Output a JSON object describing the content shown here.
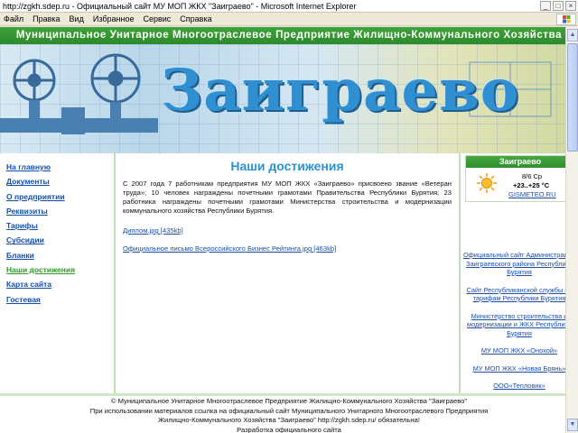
{
  "window": {
    "title": "http://zgkh.sdep.ru - Официальный сайт МУ МОП ЖКХ \"Заиграево\" - Microsoft Internet Explorer",
    "buttons": [
      "_",
      "□",
      "×"
    ]
  },
  "menubar": {
    "items": [
      "Файл",
      "Правка",
      "Вид",
      "Избранное",
      "Сервис",
      "Справка"
    ]
  },
  "header": {
    "green_bar": "Муниципальное Унитарное Многоотраслевое Предприятие Жилищно-Коммунального Хозяйства",
    "banner_title": "Заиграево"
  },
  "nav": {
    "items": [
      {
        "label": "На главную"
      },
      {
        "label": "Документы"
      },
      {
        "label": "О предприятии"
      },
      {
        "label": "Реквизиты"
      },
      {
        "label": "Тарифы"
      },
      {
        "label": "Субсидии"
      },
      {
        "label": "Бланки"
      },
      {
        "label": "Наши достижения",
        "active": true
      },
      {
        "label": "Карта сайта"
      },
      {
        "label": "Гостевая"
      }
    ]
  },
  "main": {
    "title": "Наши достижения",
    "paragraph": "С 2007 года 7 работникам предприятия МУ МОП ЖКХ «Заиграево» присвоено звание «Ветеран труда»; 10 человек награждены почетными грамотами Правительства Республики Бурятия; 23 работника награждены почетными грамотами Министерства строительства и модернизации коммунального хозяйства Республики Бурятия.",
    "links": [
      "Диплом.jpg [435kb]",
      "Официальное письмо Всероссийского Бизнес Рейтинга.jpg [463kb]"
    ]
  },
  "weather": {
    "city": "Заиграево",
    "date": "8/6 Ср",
    "temp": "+23..+25 °C",
    "source": "GISMETEO.RU"
  },
  "right_links": [
    "Официальный сайт Администрации Заиграевского района Республики Бурятия",
    "Сайт Республиканской службы по тарифам Республики Бурятия",
    "Министерство строительства и модернизации и ЖКХ Республики Бурятия",
    "МУ МОП ЖКХ «Онохой»",
    "МУ МОП ЖКХ «Новая Брянь»",
    "ООО«Тепловик»"
  ],
  "footer": {
    "line1": "© Муниципальное Унитарное Многоотраслевое Предприятие Жилищно-Коммунального Хозяйства \"Заиграево\"",
    "line2": "При использовании материалов ссылка на официальный сайт Муниципального Унитарного Многоотраслевого Предприятия",
    "line3": "Жилищно-Коммунального Хозяйства \"Заиграево\" http://zgkh.sdep.ru/ обязательна!",
    "line4": "Разработка официального сайта"
  },
  "colors": {
    "green": "#2f8f2c",
    "link": "#1a4ea8",
    "title_blue": "#2b93cf"
  }
}
